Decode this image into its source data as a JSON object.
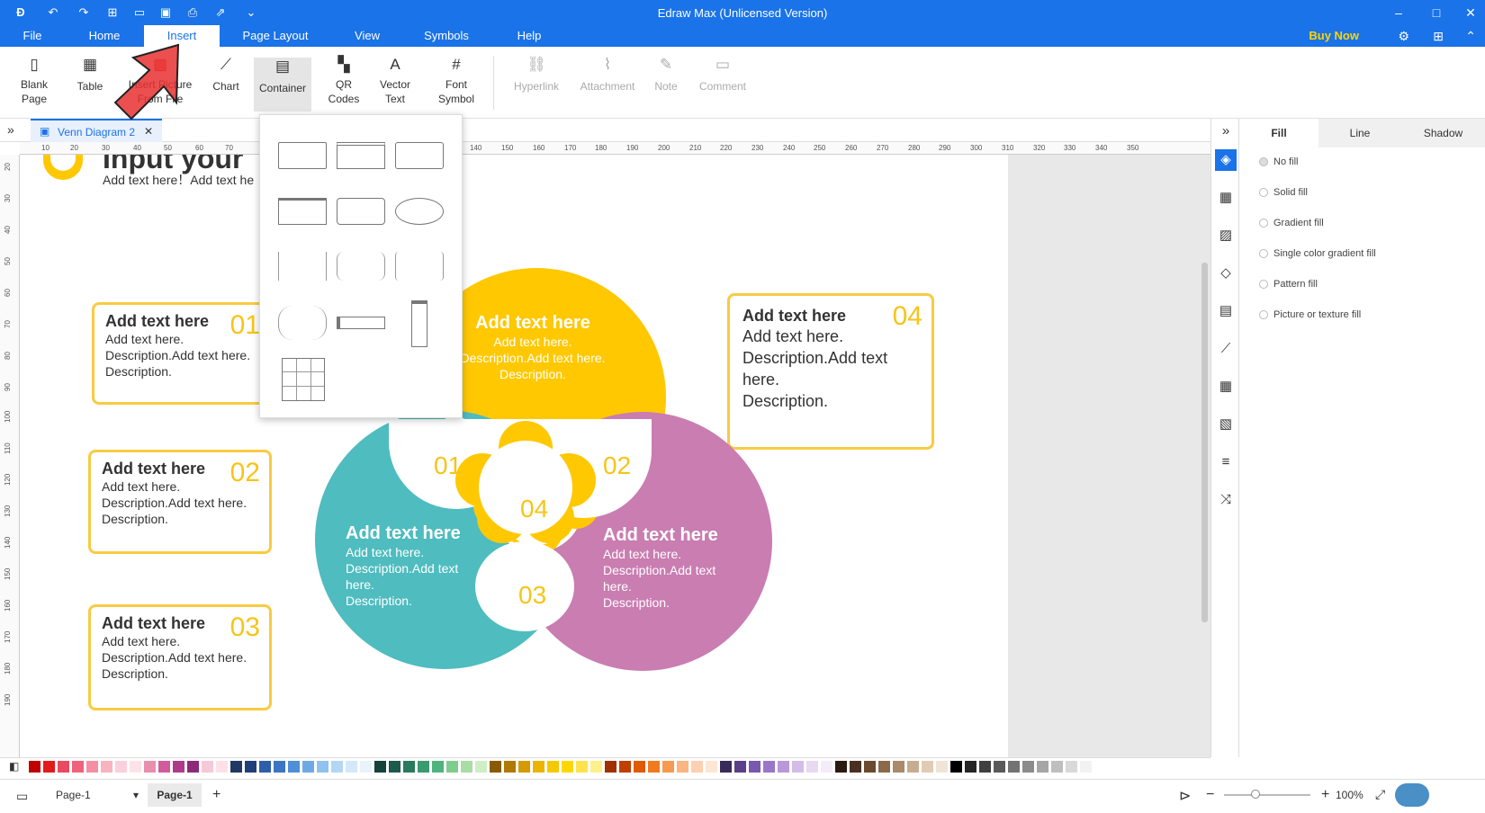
{
  "titlebar": {
    "title": "Edraw Max (Unlicensed Version)"
  },
  "menu": {
    "items": [
      "File",
      "Home",
      "Insert",
      "Page Layout",
      "View",
      "Symbols",
      "Help"
    ],
    "buy_now": "Buy Now"
  },
  "ribbon": {
    "blank_page": [
      "Blank",
      "Page"
    ],
    "table": "Table",
    "insert_picture": [
      "Insert Picture",
      "From File"
    ],
    "chart": "Chart",
    "container": "Container",
    "qr": [
      "QR",
      "Codes"
    ],
    "vector_text": [
      "Vector",
      "Text"
    ],
    "font_symbol": [
      "Font",
      "Symbol"
    ],
    "hyperlink": "Hyperlink",
    "attachment": "Attachment",
    "note": "Note",
    "comment": "Comment"
  },
  "doc_tab": {
    "label": "Venn Diagram 2"
  },
  "ruler": {
    "h_ticks": [
      "10",
      "20",
      "30",
      "40",
      "50",
      "60",
      "70",
      "140",
      "150",
      "160",
      "170",
      "180",
      "190",
      "200",
      "210",
      "220",
      "230",
      "240",
      "250",
      "260",
      "270",
      "280",
      "290",
      "300",
      "310",
      "320",
      "330",
      "340",
      "350"
    ],
    "v_ticks": [
      "20",
      "30",
      "40",
      "50",
      "60",
      "70",
      "80",
      "90",
      "100",
      "110",
      "120",
      "130",
      "140",
      "150",
      "160",
      "170",
      "180",
      "190"
    ]
  },
  "canvas": {
    "heading": "Input your",
    "subheading": "Add text here！Add text he",
    "callouts": [
      {
        "title": "Add text here",
        "line1": "Add text here.",
        "line2": "Description.Add text here.",
        "line3": "Description.",
        "num": "01"
      },
      {
        "title": "Add text here",
        "line1": "Add text here.",
        "line2": "Description.Add text here.",
        "line3": "Description.",
        "num": "02"
      },
      {
        "title": "Add text here",
        "line1": "Add text here.",
        "line2": "Description.Add text here.",
        "line3": "Description.",
        "num": "03"
      },
      {
        "title": "Add text here",
        "line1": "Add text here.",
        "line2": "Description.Add text",
        "line3": "here.",
        "line4": "Description.",
        "num": "04"
      }
    ],
    "venn": {
      "top": {
        "title": "Add text here",
        "l1": "Add text here.",
        "l2": "Description.Add text here.",
        "l3": "Description.",
        "color": "#ffc800"
      },
      "left": {
        "title": "Add text here",
        "l1": "Add text here.",
        "l2": "Description.Add text",
        "l3": "here.",
        "l4": "Description.",
        "color": "#4fbcbf"
      },
      "right": {
        "title": "Add text here",
        "l1": "Add text here.",
        "l2": "Description.Add text",
        "l3": "here.",
        "l4": "Description.",
        "color": "#c97db1"
      },
      "n01": "01",
      "n02": "02",
      "n03": "03",
      "n04": "04"
    }
  },
  "panel": {
    "tabs": [
      "Fill",
      "Line",
      "Shadow"
    ],
    "options": [
      "No fill",
      "Solid fill",
      "Gradient fill",
      "Single color gradient fill",
      "Pattern fill",
      "Picture or texture fill"
    ]
  },
  "statusbar": {
    "page_select": "Page-1",
    "page_tab": "Page-1",
    "zoom": "100%"
  },
  "colors": {
    "accent": "#1a73e8",
    "yellow": "#f9cb43"
  }
}
